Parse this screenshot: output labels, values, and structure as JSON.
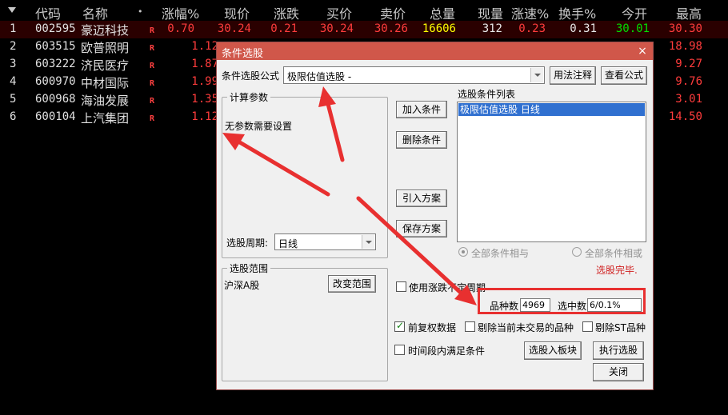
{
  "table": {
    "headers": {
      "code": "代码",
      "name": "名称",
      "dot": "•",
      "change_pct": "涨幅%",
      "price": "现价",
      "change": "涨跌",
      "bid": "买价",
      "ask": "卖价",
      "volume": "总量",
      "cur_vol": "现量",
      "speed": "涨速%",
      "turnover": "换手%",
      "open": "今开",
      "high": "最高"
    },
    "rows": [
      {
        "idx": "1",
        "code": "002595",
        "name": "豪迈科技",
        "flag": "R",
        "change_pct": "0.70",
        "price": "30.24",
        "change": "0.21",
        "bid": "30.24",
        "ask": "30.26",
        "volume": "16606",
        "cur_vol": "312",
        "speed": "0.23",
        "turnover": "0.31",
        "open": "30.01",
        "high": "30.30"
      },
      {
        "idx": "2",
        "code": "603515",
        "name": "欧普照明",
        "flag": "R",
        "change_pct": "1.12",
        "high": "18.98"
      },
      {
        "idx": "3",
        "code": "603222",
        "name": "济民医疗",
        "flag": "R",
        "change_pct": "1.87",
        "high": "9.27"
      },
      {
        "idx": "4",
        "code": "600970",
        "name": "中材国际",
        "flag": "R",
        "change_pct": "1.99",
        "high": "9.76"
      },
      {
        "idx": "5",
        "code": "600968",
        "name": "海油发展",
        "flag": "R",
        "change_pct": "1.35",
        "high": "3.01"
      },
      {
        "idx": "6",
        "code": "600104",
        "name": "上汽集团",
        "flag": "R",
        "change_pct": "1.12",
        "high": "14.50"
      }
    ]
  },
  "dialog": {
    "title": "条件选股",
    "close": "×",
    "formula_label": "条件选股公式",
    "formula_value": "极限估值选股 -",
    "usage_button": "用法注释",
    "view_formula_button": "查看公式",
    "calc_params_title": "计算参数",
    "no_params_text": "无参数需要设置",
    "period_label": "选股周期:",
    "period_value": "日线",
    "add_condition": "加入条件",
    "delete_condition": "删除条件",
    "import_plan": "引入方案",
    "save_plan": "保存方案",
    "condition_list_label": "选股条件列表",
    "condition_item": "极限估值选股  日线",
    "radio_and": "全部条件相与",
    "radio_or": "全部条件相或",
    "status": "选股完毕.",
    "range_title": "选股范围",
    "range_value": "沪深A股",
    "change_range_button": "改变范围",
    "use_fixed_period": "使用涨跌不定周期",
    "count_label": "品种数",
    "count_value": "4969",
    "selected_label": "选中数",
    "selected_value": "6/0.1%",
    "pre_adjusted": "前复权数据",
    "exclude_untraded": "剔除当前未交易的品种",
    "exclude_st": "剔除ST品种",
    "time_range_condition": "时间段内满足条件",
    "to_board_button": "选股入板块",
    "execute_button": "执行选股",
    "close_button": "关闭"
  },
  "colors": {
    "up_red": "#ff3c3c",
    "open_green": "#00e000",
    "volume_yellow": "#ffff00",
    "title_bar": "#d0574a",
    "annotation_red": "#e83030"
  }
}
